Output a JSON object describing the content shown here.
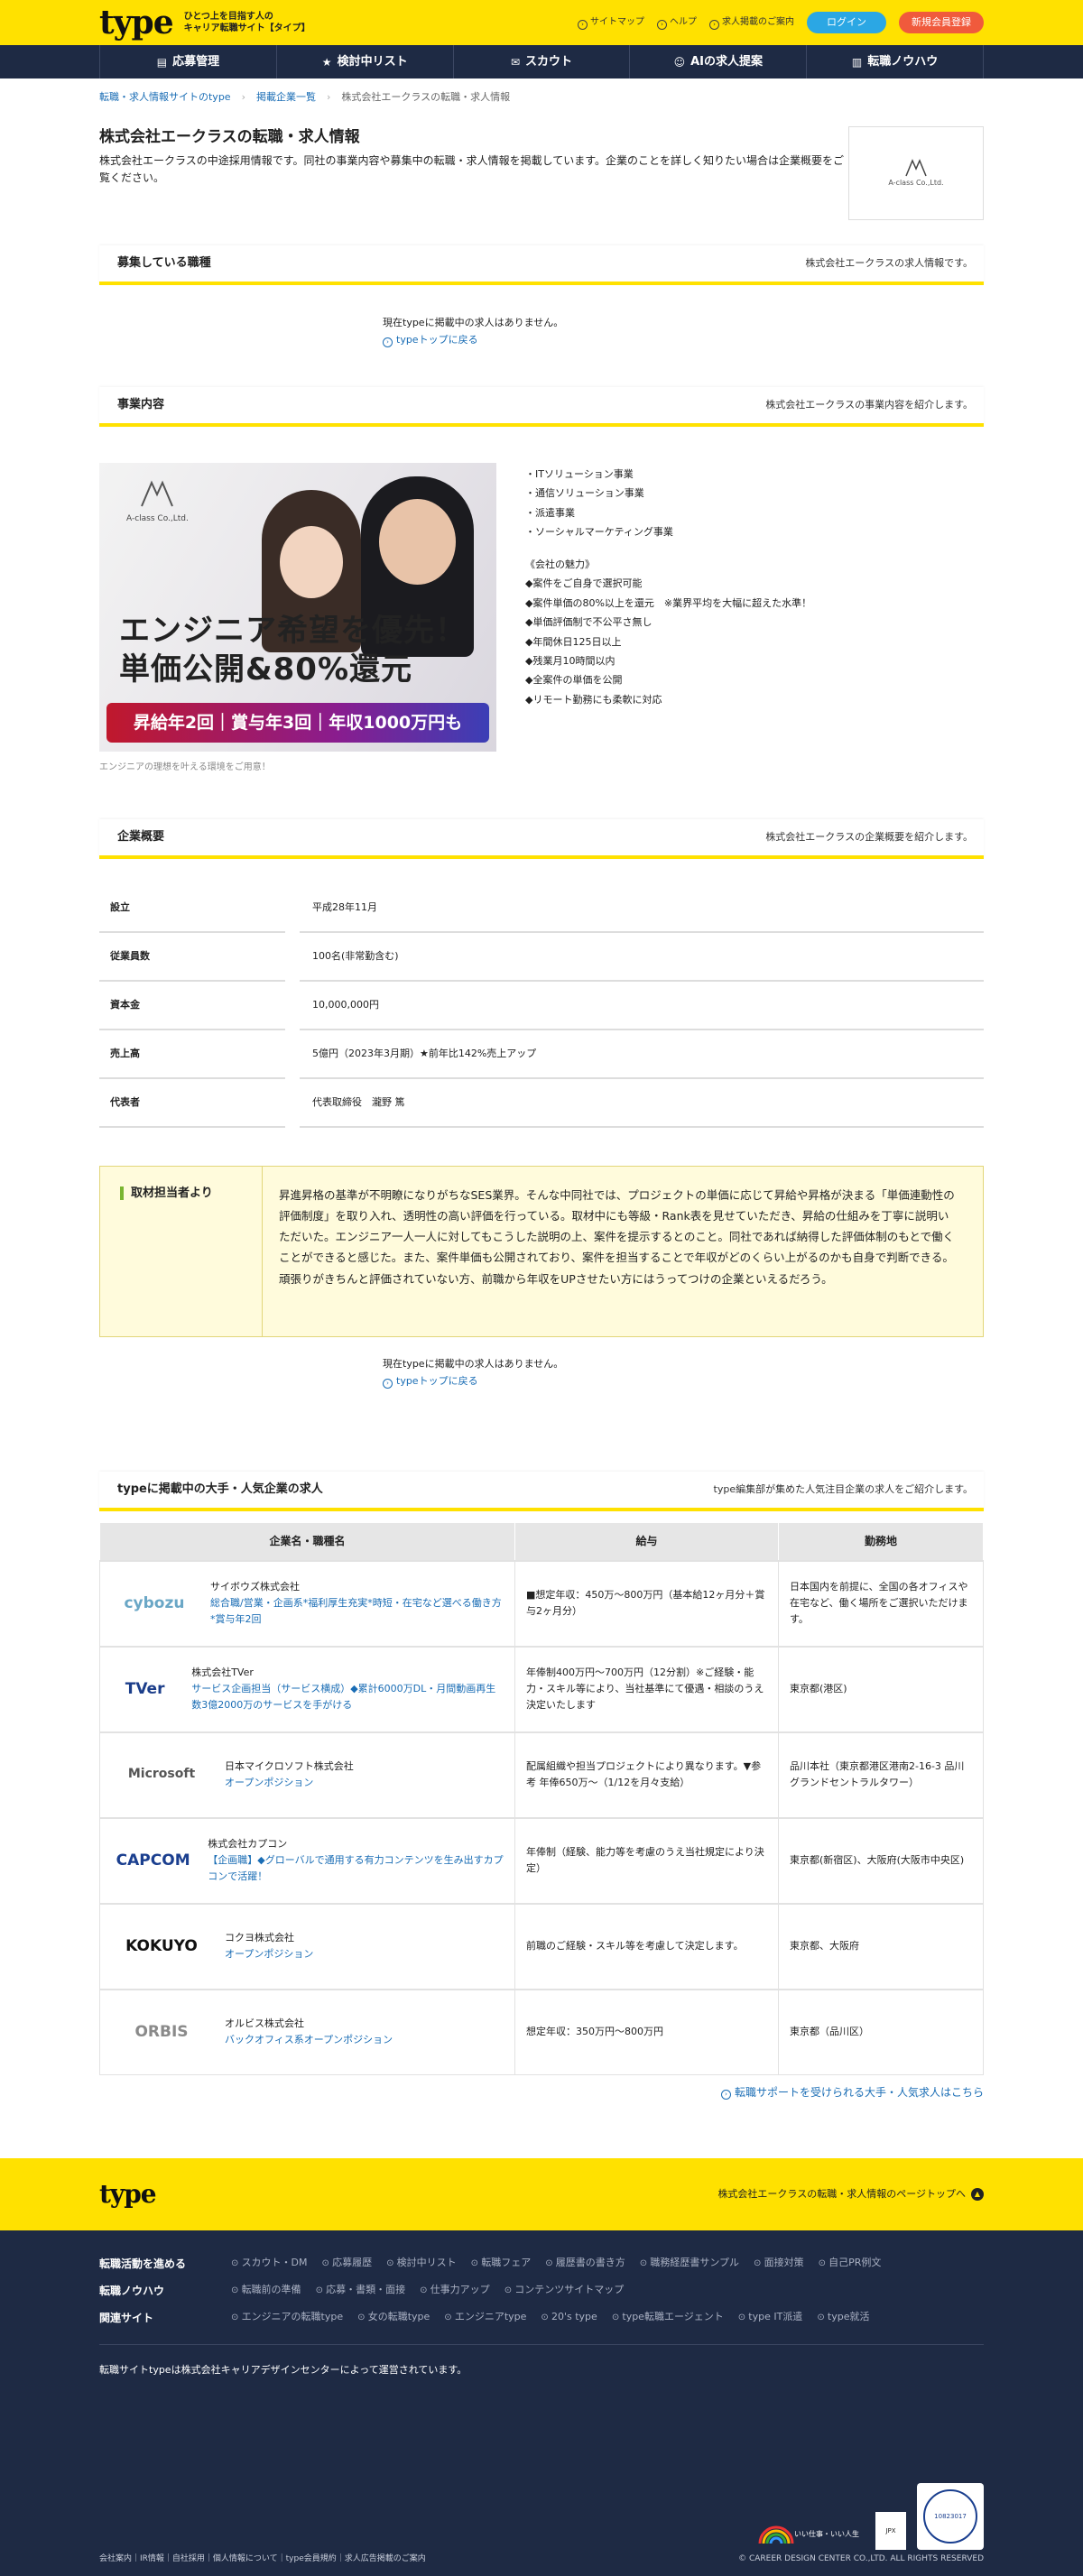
{
  "header": {
    "logo": "type",
    "tagline1": "ひとつ上を目指す人の",
    "tagline2": "キャリア転職サイト【タイプ】",
    "links": [
      "サイトマップ",
      "ヘルプ",
      "求人掲載のご案内"
    ],
    "login": "ログイン",
    "register": "新規会員登録"
  },
  "nav": [
    {
      "icon": "▤",
      "label": "応募管理"
    },
    {
      "icon": "★",
      "label": "検討中リスト"
    },
    {
      "icon": "✉",
      "label": "スカウト"
    },
    {
      "icon": "☺",
      "label": "AIの求人提案"
    },
    {
      "icon": "▥",
      "label": "転職ノウハウ"
    }
  ],
  "breadcrumb": [
    "転職・求人情報サイトのtype",
    "掲載企業一覧",
    "株式会社エークラスの転職・求人情報"
  ],
  "company": {
    "title": "株式会社エークラスの転職・求人情報",
    "desc": "株式会社エークラスの中途採用情報です。同社の事業内容や募集中の転職・求人情報を掲載しています。企業のことを詳しく知りたい場合は企業概要をご覧ください。",
    "logo_text": "A-class Co.,Ltd."
  },
  "jobs": {
    "title": "募集している職種",
    "sub": "株式会社エークラスの求人情報です。",
    "empty": "現在typeに掲載中の求人はありません。",
    "back": "typeトップに戻る"
  },
  "business": {
    "title": "事業内容",
    "sub": "株式会社エークラスの事業内容を紹介します。",
    "image_logo": "A-class Co.,Ltd.",
    "image_line1": "エンジニア希望を優先！",
    "image_line2": "単価公開&80%還元",
    "image_banner": "昇給年2回｜賞与年3回｜年収1000万円も",
    "caption": "エンジニアの理想を叶える環境をご用意！",
    "list": [
      "・ITソリューション事業",
      "・通信ソリューション事業",
      "・派遣事業",
      "・ソーシャルマーケティング事業",
      "",
      "《会社の魅力》",
      "◆案件をご自身で選択可能",
      "◆案件単価の80%以上を還元　※業界平均を大幅に超えた水準！",
      "◆単価評価制で不公平さ無し",
      "◆年間休日125日以上",
      "◆残業月10時間以内",
      "◆全案件の単価を公開",
      "◆リモート勤務にも柔軟に対応"
    ]
  },
  "overview": {
    "title": "企業概要",
    "sub": "株式会社エークラスの企業概要を紹介します。",
    "rows": [
      {
        "k": "設立",
        "v": "平成28年11月"
      },
      {
        "k": "従業員数",
        "v": "100名(非常勤含む)"
      },
      {
        "k": "資本金",
        "v": "10,000,000円"
      },
      {
        "k": "売上高",
        "v": "5億円（2023年3月期）★前年比142%売上アップ"
      },
      {
        "k": "代表者",
        "v": "代表取締役　瀧野 篤"
      }
    ]
  },
  "interview": {
    "label": "取材担当者より",
    "text": "昇進昇格の基準が不明瞭になりがちなSES業界。そんな中同社では、プロジェクトの単価に応じて昇給や昇格が決まる「単価連動性の評価制度」を取り入れ、透明性の高い評価を行っている。取材中にも等級・Rank表を見せていただき、昇給の仕組みを丁寧に説明いただいた。エンジニア一人一人に対してもこうした説明の上、案件を提示するとのこと。同社であれば納得した評価体制のもとで働くことができると感じた。また、案件単価も公開されており、案件を担当することで年収がどのくらい上がるのかも自身で判断できる。頑張りがきちんと評価されていない方、前職から年収をUPさせたい方にはうってつけの企業といえるだろう。",
    "empty": "現在typeに掲載中の求人はありません。",
    "back": "typeトップに戻る"
  },
  "popular": {
    "title": "typeに掲載中の大手・人気企業の求人",
    "sub": "type編集部が集めた人気注目企業の求人をご紹介します。",
    "headers": [
      "企業名・職種名",
      "給与",
      "勤務地"
    ],
    "rows": [
      {
        "logo": "cybozu",
        "logo_color": "#6aa7c6",
        "company": "サイボウズ株式会社",
        "job": "総合職/営業・企画系*福利厚生充実*時短・在宅など選べる働き方*賞与年2回",
        "salary": "■想定年収：450万～800万円（基本給12ヶ月分＋賞与2ヶ月分）",
        "location": "日本国内を前提に、全国の各オフィスや在宅など、働く場所をご選択いただけます。"
      },
      {
        "logo": "TVer",
        "logo_color": "#1c3e8a",
        "company": "株式会社TVer",
        "job": "サービス企画担当（サービス横成）◆累計6000万DL・月間動画再生数3億2000万のサービスを手がける",
        "salary": "年俸制400万円～700万円（12分割）※ご経験・能力・スキル等により、当社基準にて優遇・相談のうえ決定いたします",
        "location": "東京都(港区)"
      },
      {
        "logo": "Microsoft",
        "logo_color": "#555555",
        "company": "日本マイクロソフト株式会社",
        "job": "オープンポジション",
        "salary": "配属組織や担当プロジェクトにより異なります。▼参考 年俸650万～（1/12を月々支給）",
        "location": "品川本社（東京都港区港南2-16-3 品川グランドセントラルタワー）"
      },
      {
        "logo": "CAPCOM",
        "logo_color": "#1b3f8f",
        "company": "株式会社カプコン",
        "job": "【企画職】◆グローバルで通用する有力コンテンツを生み出すカプコンで活躍！",
        "salary": "年俸制（経験、能力等を考慮のうえ当社規定により決定）",
        "location": "東京都(新宿区)、大阪府(大阪市中央区)"
      },
      {
        "logo": "KOKUYO",
        "logo_color": "#111111",
        "company": "コクヨ株式会社",
        "job": "オープンポジション",
        "salary": "前職のご経験・スキル等を考慮して決定します。",
        "location": "東京都、大阪府"
      },
      {
        "logo": "ORBIS",
        "logo_color": "#8a8a8a",
        "company": "オルビス株式会社",
        "job": "バックオフィス系オープンポジション",
        "salary": "想定年収：350万円～800万円",
        "location": "東京都（品川区）"
      }
    ],
    "more": "転職サポートを受けられる大手・人気求人はこちら"
  },
  "footer": {
    "logo": "type",
    "top_link": "株式会社エークラスの転職・求人情報のページトップへ",
    "rows": [
      {
        "head": "転職活動を進める",
        "items": [
          "スカウト・DM",
          "応募履歴",
          "検討中リスト",
          "転職フェア",
          "履歴書の書き方",
          "職務経歴書サンプル",
          "面接対策",
          "自己PR例文"
        ]
      },
      {
        "head": "転職ノウハウ",
        "items": [
          "転職前の準備",
          "応募・書類・面接",
          "仕事力アップ",
          "コンテンツサイトマップ"
        ]
      },
      {
        "head": "関連サイト",
        "items": [
          "エンジニアの転職type",
          "女の転職type",
          "エンジニアtype",
          "20's type",
          "type転職エージェント",
          "type IT派遣",
          "type就活"
        ]
      }
    ],
    "note": "転職サイトtypeは株式会社キャリアデザインセンターによって運営されています。",
    "badge1": "いい仕事・いい人生",
    "badge2": "JPX",
    "badge3": "10823017",
    "bottom_links": "会社案内｜IR情報｜自社採用｜個人情報について｜type会員規約｜求人広告掲載のご案内",
    "copyright": "© CAREER DESIGN CENTER CO.,LTD. ALL RIGHTS RESERVED"
  }
}
